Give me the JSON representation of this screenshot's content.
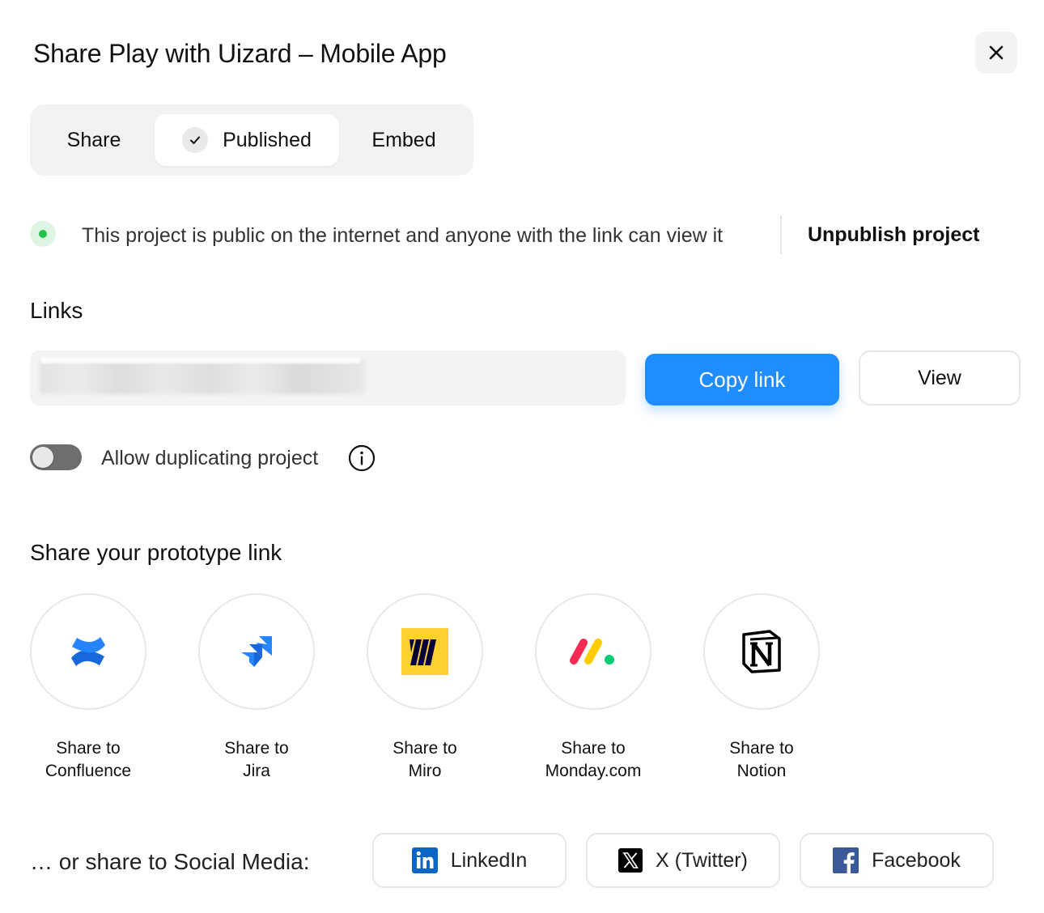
{
  "dialog": {
    "title": "Share Play with Uizard – Mobile App"
  },
  "tabs": [
    {
      "label": "Share",
      "selected": false
    },
    {
      "label": "Published",
      "selected": true
    },
    {
      "label": "Embed",
      "selected": false
    }
  ],
  "status": {
    "text": "This project is public on the internet and anyone with the link can view it",
    "color": "#22c24a",
    "unpublish_label": "Unpublish project"
  },
  "links": {
    "heading": "Links",
    "copy_label": "Copy link",
    "view_label": "View",
    "accent": "#1f8cff"
  },
  "duplicate": {
    "label": "Allow duplicating project",
    "enabled": false
  },
  "share_section": {
    "heading": "Share your prototype link",
    "items": [
      {
        "line1": "Share to",
        "line2": "Confluence",
        "icon": "confluence-icon"
      },
      {
        "line1": "Share to",
        "line2": "Jira",
        "icon": "jira-icon"
      },
      {
        "line1": "Share to",
        "line2": "Miro",
        "icon": "miro-icon"
      },
      {
        "line1": "Share to",
        "line2": "Monday.com",
        "icon": "monday-icon"
      },
      {
        "line1": "Share to",
        "line2": "Notion",
        "icon": "notion-icon"
      }
    ]
  },
  "social": {
    "label": "… or share to Social Media:",
    "buttons": [
      {
        "label": "LinkedIn",
        "icon": "linkedin-icon",
        "color": "#0a66c2"
      },
      {
        "label": "X (Twitter)",
        "icon": "x-icon",
        "color": "#000000"
      },
      {
        "label": "Facebook",
        "icon": "facebook-icon",
        "color": "#3b5998"
      }
    ]
  }
}
